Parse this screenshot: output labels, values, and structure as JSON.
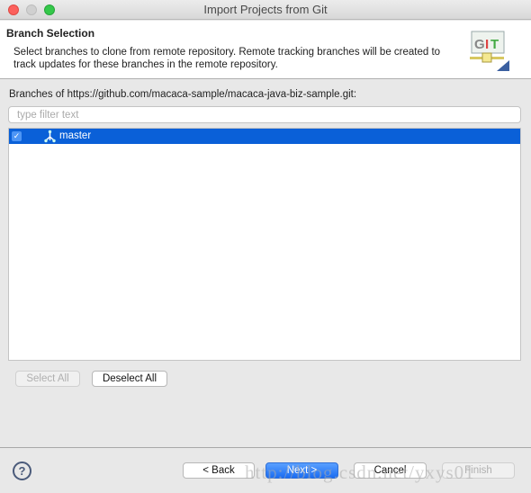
{
  "window": {
    "title": "Import Projects from Git"
  },
  "header": {
    "title": "Branch Selection",
    "description": "Select branches to clone from remote repository. Remote tracking branches will be created to track updates for these branches in the remote repository.",
    "icon": "git-icon",
    "icon_text": "GIT"
  },
  "branches_label": "Branches of https://github.com/macaca-sample/macaca-java-biz-sample.git:",
  "filter": {
    "placeholder": "type filter text",
    "value": ""
  },
  "branches": [
    {
      "label": "master",
      "checked": true,
      "selected": true,
      "icon": "branch-icon"
    }
  ],
  "selection_buttons": {
    "select_all": "Select All",
    "deselect_all": "Deselect All"
  },
  "footer": {
    "help": "?",
    "back": "< Back",
    "next": "Next >",
    "cancel": "Cancel",
    "finish": "Finish"
  },
  "watermark": "http://blog.csdn.net/yxys01",
  "colors": {
    "selection": "#0a60d8",
    "default_button": "#1a6cf2"
  }
}
